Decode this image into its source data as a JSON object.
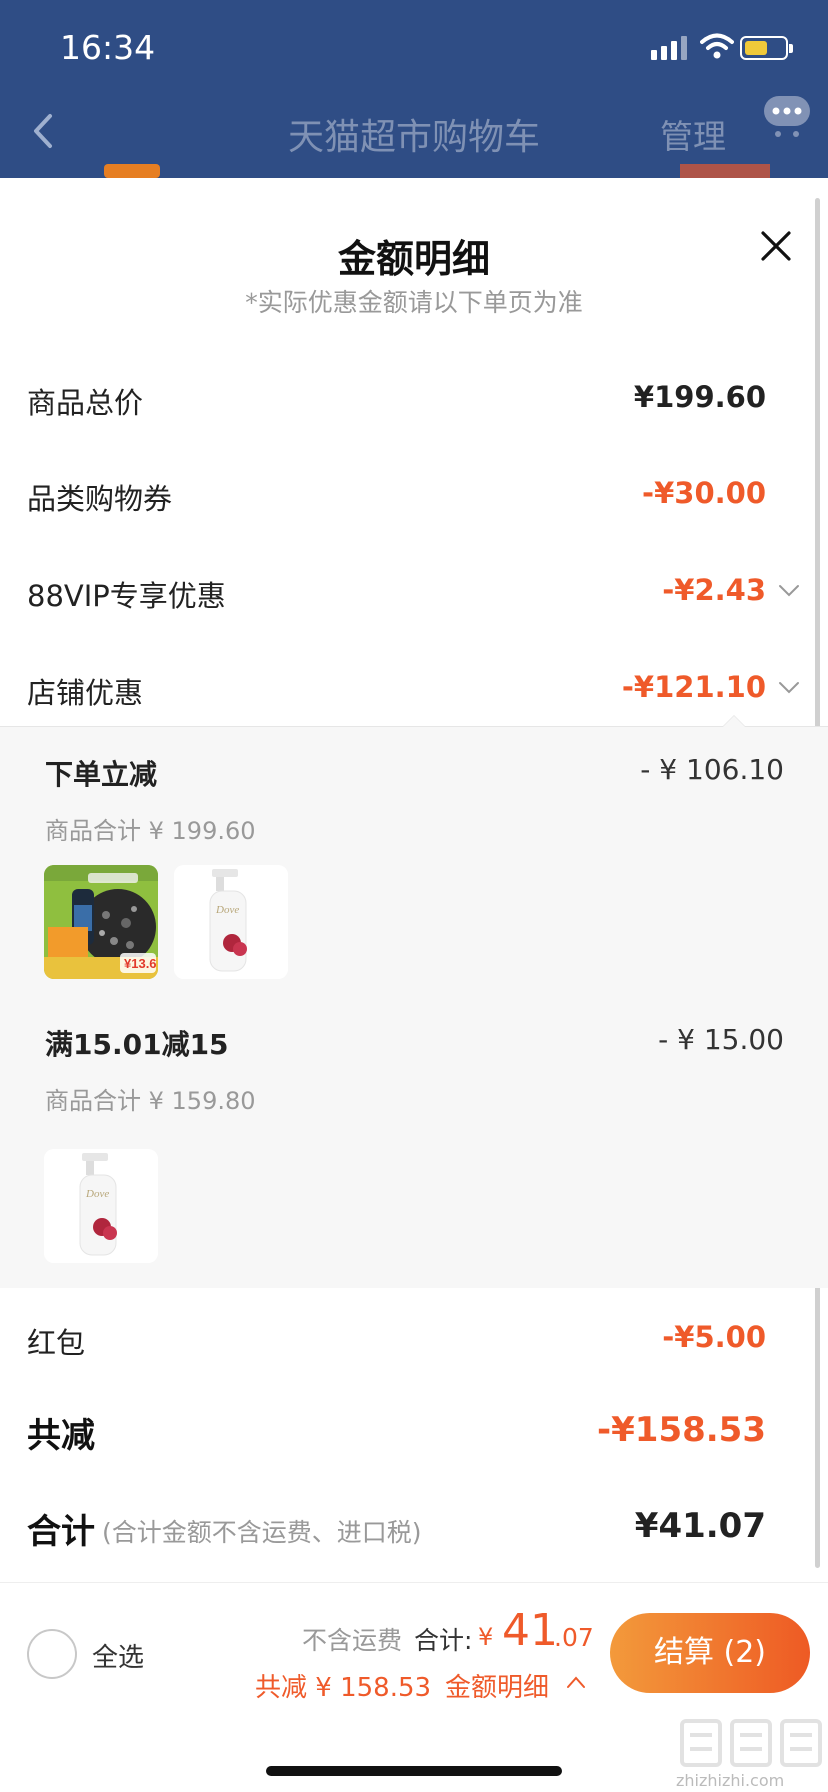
{
  "status_bar": {
    "time": "16:34"
  },
  "nav": {
    "title": "天猫超市购物车",
    "manage_label": "管理"
  },
  "sheet": {
    "title": "金额明细",
    "subtitle": "*实际优惠金额请以下单页为准",
    "rows": {
      "total": {
        "label": "商品总价",
        "value": "¥199.60"
      },
      "coupon": {
        "label": "品类购物券",
        "value": "-¥30.00"
      },
      "vip": {
        "label": "88VIP专享优惠",
        "value": "-¥2.43"
      },
      "shop": {
        "label": "店铺优惠",
        "value": "-¥121.10"
      },
      "hongbao": {
        "label": "红包",
        "value": "-¥5.00"
      }
    },
    "shop_detail": [
      {
        "name": "下单立减",
        "amount": "- ¥ 106.10",
        "subtotal": "商品合计 ¥ 199.60"
      },
      {
        "name": "满15.01减15",
        "amount": "- ¥ 15.00",
        "subtotal": "商品合计 ¥ 159.80"
      }
    ],
    "product_thumb_text": {
      "price_badge": "¥13.6",
      "brand": "Dove"
    },
    "total_less": {
      "label": "共减",
      "value": "-¥158.53"
    },
    "grand_total": {
      "label": "合计",
      "note": "(合计金额不含运费、进口税)",
      "value": "¥41.07"
    }
  },
  "bottom_bar": {
    "select_all_label": "全选",
    "no_shipping_label": "不含运费",
    "sum_label": "合计:",
    "sum_currency": "¥",
    "sum_integer": "41",
    "sum_decimal": ".07",
    "less_label": "共减 ¥ 158.53",
    "detail_link": "金额明细",
    "checkout_label": "结算 (2)"
  },
  "colors": {
    "nav_bg": "#2f4d85",
    "accent": "#ef5a2a",
    "detail_bg": "#f7f7f7"
  },
  "watermark": {
    "url": "zhizhizhi.com"
  }
}
